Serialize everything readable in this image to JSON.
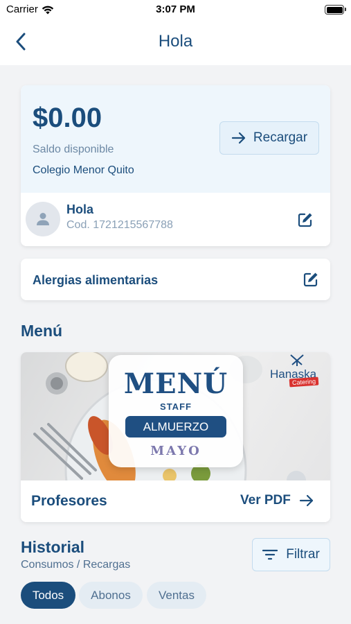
{
  "status_bar": {
    "carrier": "Carrier",
    "time": "3:07 PM"
  },
  "nav": {
    "title": "Hola",
    "back_icon": "chevron-left-icon"
  },
  "balance": {
    "amount": "$0.00",
    "label": "Saldo disponible",
    "school": "Colegio Menor Quito",
    "recharge_label": "Recargar"
  },
  "user": {
    "name": "Hola",
    "code": "Cod. 1721215567788"
  },
  "allergies": {
    "label": "Alergias alimentarias"
  },
  "menu_section": {
    "title": "Menú",
    "image": {
      "heading": "MENÚ",
      "subheading": "STAFF",
      "meal": "ALMUERZO",
      "month": "MAYO",
      "brand": "Hanaska",
      "brand_tag": "Catering"
    },
    "card_label": "Profesores",
    "pdf_label": "Ver PDF"
  },
  "history": {
    "title": "Historial",
    "subtitle": "Consumos / Recargas",
    "filter_label": "Filtrar",
    "chips": [
      {
        "label": "Todos",
        "active": true
      },
      {
        "label": "Abonos",
        "active": false
      },
      {
        "label": "Ventas",
        "active": false
      }
    ]
  },
  "colors": {
    "primary": "#1b4d7c",
    "card_tint": "#eef6fc",
    "background": "#f2f3f5",
    "brand_red": "#d9322f"
  }
}
